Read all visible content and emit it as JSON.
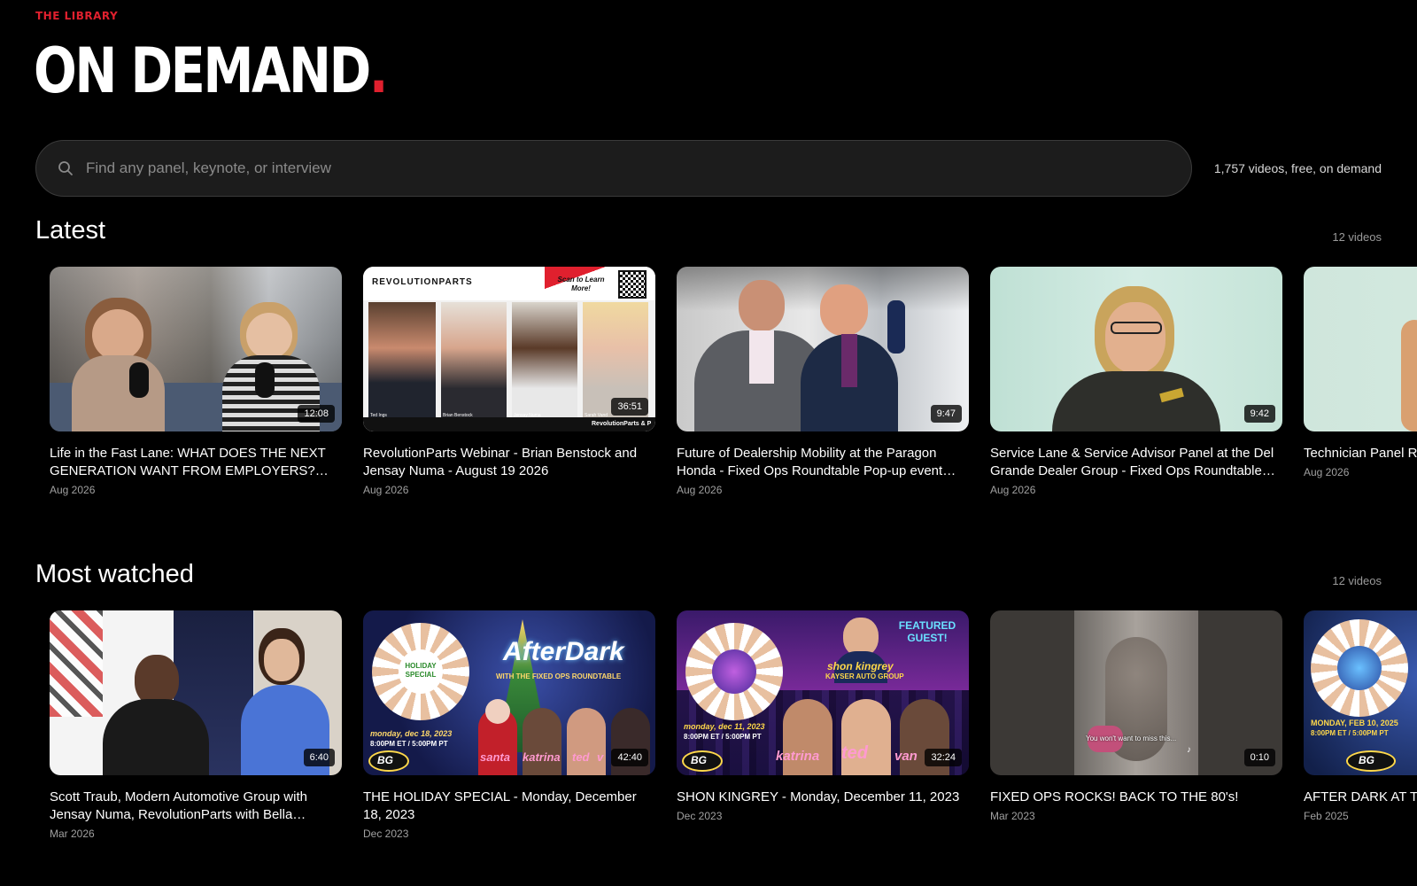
{
  "header": {
    "kicker": "THE LIBRARY",
    "title": "ON DEMAND",
    "title_dot": ".",
    "accent_color": "#e0202e"
  },
  "search": {
    "placeholder": "Find any panel, keynote, or interview",
    "value": "",
    "icon": "search-icon",
    "video_count_text": "1,757 videos, free, on demand"
  },
  "sections": [
    {
      "title": "Latest",
      "count": "12 videos",
      "videos": [
        {
          "title": "Life in the Fast Lane: WHAT DOES THE NEXT GENERATION WANT FROM EMPLOYERS?…",
          "date": "Aug 2026",
          "duration": "12:08"
        },
        {
          "title": "RevolutionParts Webinar - Brian Benstock and Jensay Numa - August 19 2026",
          "date": "Aug 2026",
          "duration": "36:51",
          "thumb_text": {
            "brand": "REVOLUTIONPARTS",
            "cta": "Scan to Learn More!",
            "footer": "RevolutionParts & P",
            "names": [
              "Ted Ings",
              "Brian Benstock",
              "Jensay Numa",
              "Sarah Vand"
            ]
          }
        },
        {
          "title": "Future of Dealership Mobility at the Paragon Honda - Fixed Ops Roundtable Pop-up event in…",
          "date": "Aug 2026",
          "duration": "9:47"
        },
        {
          "title": "Service Lane & Service Advisor Panel at the Del Grande Dealer Group - Fixed Ops Roundtable…",
          "date": "Aug 2026",
          "duration": "9:42"
        },
        {
          "title": "Technician Panel Re Dealer Group - Fixe",
          "date": "Aug 2026",
          "duration": ""
        }
      ]
    },
    {
      "title": "Most watched",
      "count": "12 videos",
      "videos": [
        {
          "title": "Scott Traub, Modern Automotive Group with Jensay Numa, RevolutionParts with Bella Smyli…",
          "date": "Mar 2026",
          "duration": "6:40"
        },
        {
          "title": "THE HOLIDAY SPECIAL - Monday, December 18, 2023",
          "date": "Dec 2023",
          "duration": "42:40",
          "thumb_text": {
            "headline": "AfterDark",
            "sub": "WITH THE FIXED OPS ROUNDTABLE",
            "date": "monday, dec 18, 2023",
            "time": "8:00PM ET / 5:00PM PT",
            "badge": "HOLIDAY SPECIAL",
            "names": [
              "santa",
              "katrina",
              "ted",
              "v"
            ]
          }
        },
        {
          "title": "SHON KINGREY - Monday, December 11, 2023",
          "date": "Dec 2023",
          "duration": "32:24",
          "thumb_text": {
            "featured": "FEATURED GUEST!",
            "guest": "shon kingrey",
            "guest_org": "KAYSER AUTO GROUP",
            "date": "monday, dec 11, 2023",
            "time": "8:00PM ET / 5:00PM PT",
            "names": [
              "katrina",
              "ted",
              "van"
            ]
          }
        },
        {
          "title": "FIXED OPS ROCKS! BACK TO THE 80's!",
          "date": "Mar 2023",
          "duration": "0:10",
          "thumb_text": {
            "caption": "You won't want to miss this..."
          }
        },
        {
          "title": "AFTER DARK AT TH ROUNDTABLE: Mo",
          "date": "Feb 2025",
          "duration": "",
          "thumb_text": {
            "date": "MONDAY, FEB 10, 2025",
            "time": "8:00PM ET / 5:00PM PT"
          }
        }
      ]
    }
  ]
}
